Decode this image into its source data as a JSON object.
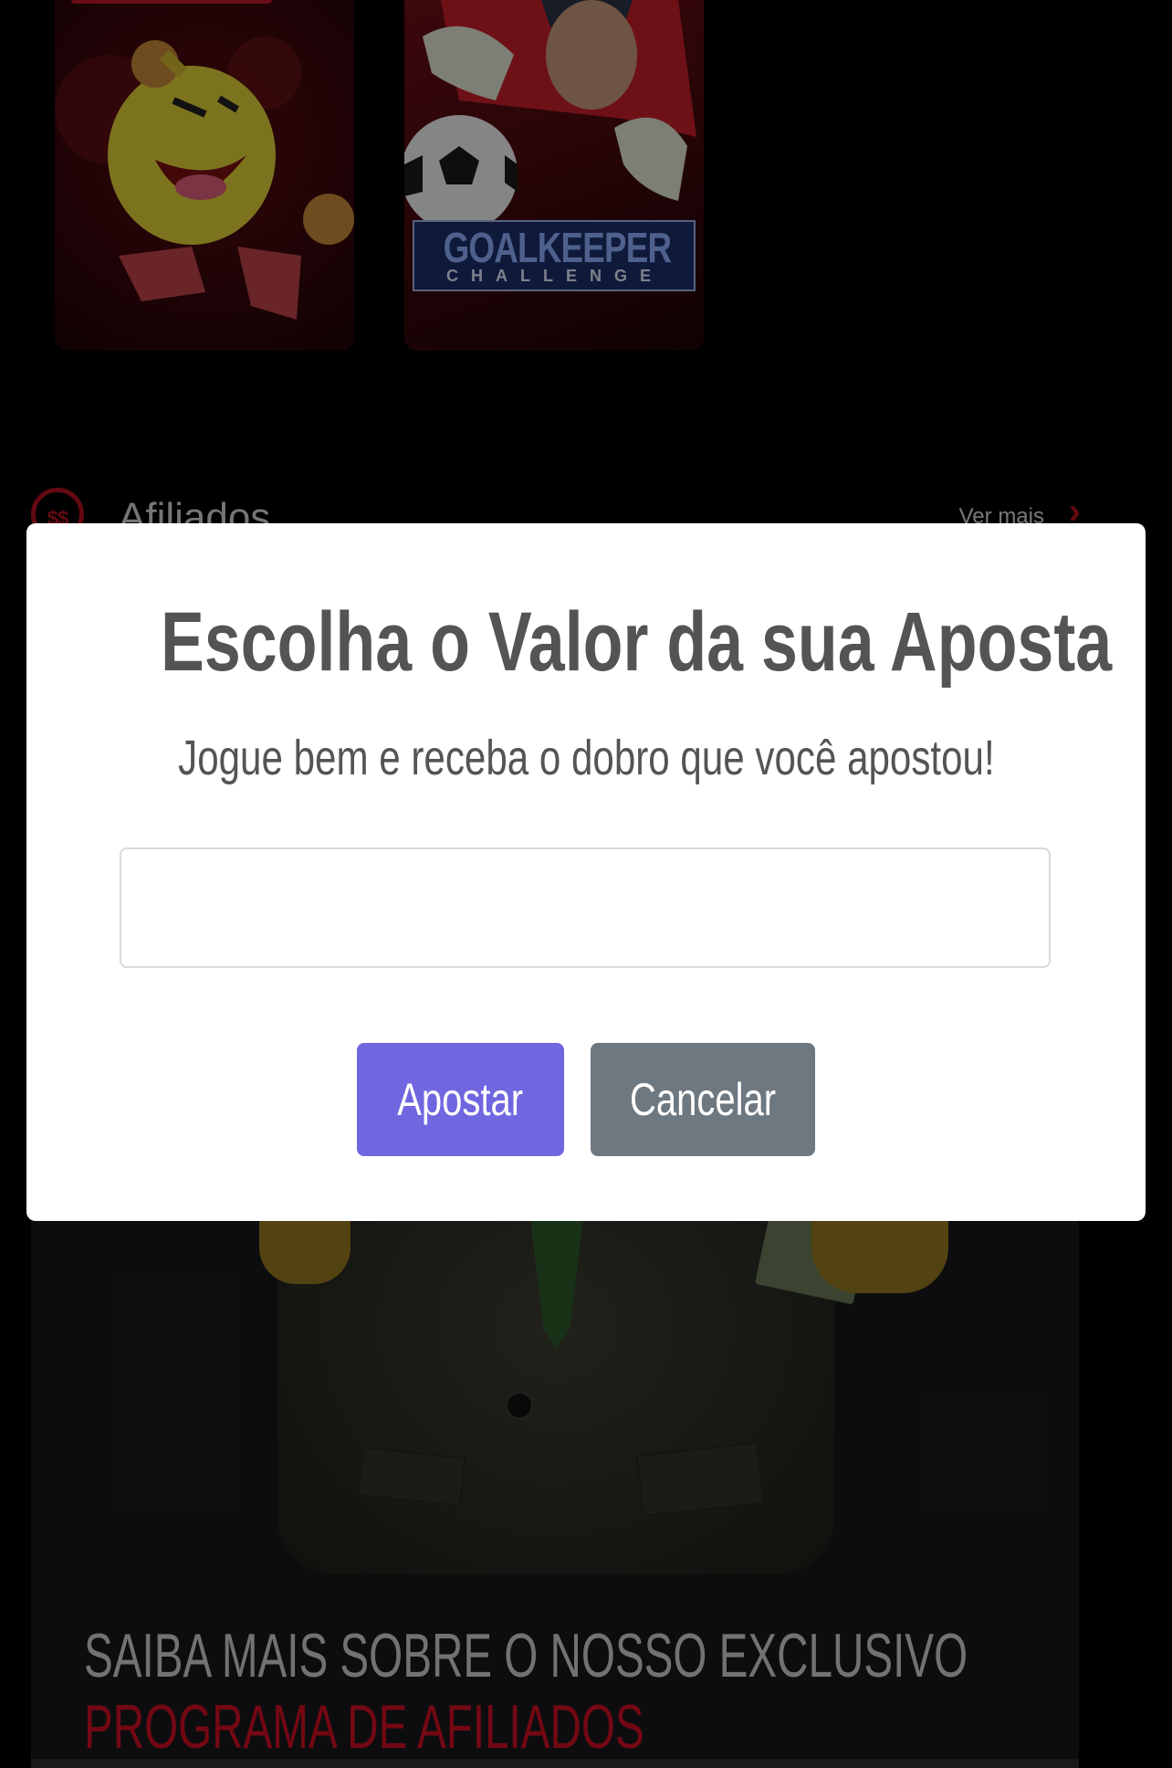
{
  "games": [
    {
      "name": "pacman-game",
      "caption": ""
    },
    {
      "name": "goalkeeper-game",
      "logo_line1": "GOALKEEPER",
      "logo_line2": "CHALLENGE"
    }
  ],
  "section": {
    "title": "Afiliados",
    "more": "Ver mais",
    "icon": "dollar-icon"
  },
  "promo": {
    "line1": "SAIBA MAIS SOBRE O NOSSO EXCLUSIVO",
    "line2": "PROGRAMA DE AFILIADOS"
  },
  "modal": {
    "title": "Escolha o Valor da sua Aposta",
    "text": "Jogue bem e receba o dobro que você apostou!",
    "input_value": "",
    "confirm_label": "Apostar",
    "cancel_label": "Cancelar"
  },
  "colors": {
    "accent_red": "#d20f24",
    "confirm": "#7066e0",
    "cancel": "#6e7881"
  }
}
